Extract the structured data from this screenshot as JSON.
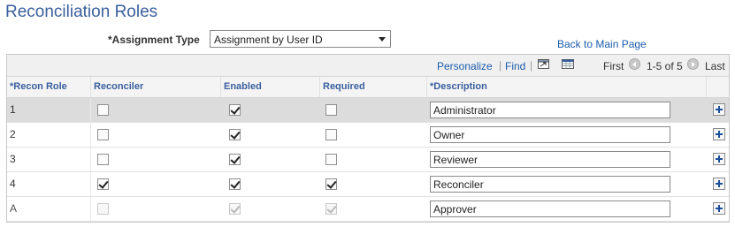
{
  "page": {
    "title": "Reconciliation Roles",
    "back_link": "Back to Main Page"
  },
  "assignment": {
    "label": "*Assignment Type",
    "value": "Assignment by User ID"
  },
  "grid_nav": {
    "personalize": "Personalize",
    "sep1": "|",
    "find": "Find",
    "sep2": "|",
    "first": "First",
    "range": "1-5 of 5",
    "last": "Last",
    "icons": [
      "view-all-icon",
      "download-icon",
      "previous-arrow-icon",
      "next-arrow-icon"
    ]
  },
  "columns": [
    "*Recon Role",
    "Reconciler",
    "Enabled",
    "Required",
    "*Description"
  ],
  "rows": [
    {
      "role": "1",
      "reconciler": false,
      "enabled": true,
      "required": false,
      "description": "Administrator",
      "selected": true,
      "disabled": false
    },
    {
      "role": "2",
      "reconciler": false,
      "enabled": true,
      "required": false,
      "description": "Owner",
      "selected": false,
      "disabled": false
    },
    {
      "role": "3",
      "reconciler": false,
      "enabled": true,
      "required": false,
      "description": "Reviewer",
      "selected": false,
      "disabled": false
    },
    {
      "role": "4",
      "reconciler": true,
      "enabled": true,
      "required": true,
      "description": "Reconciler",
      "selected": false,
      "disabled": false
    },
    {
      "role": "A",
      "reconciler": false,
      "enabled": true,
      "required": true,
      "description": "Approver",
      "selected": false,
      "disabled": true
    }
  ],
  "colors": {
    "title": "#3a5f9e",
    "link": "#1b5bad",
    "header_text": "#3a5f9e",
    "selected_row": "#dcdcdc"
  }
}
